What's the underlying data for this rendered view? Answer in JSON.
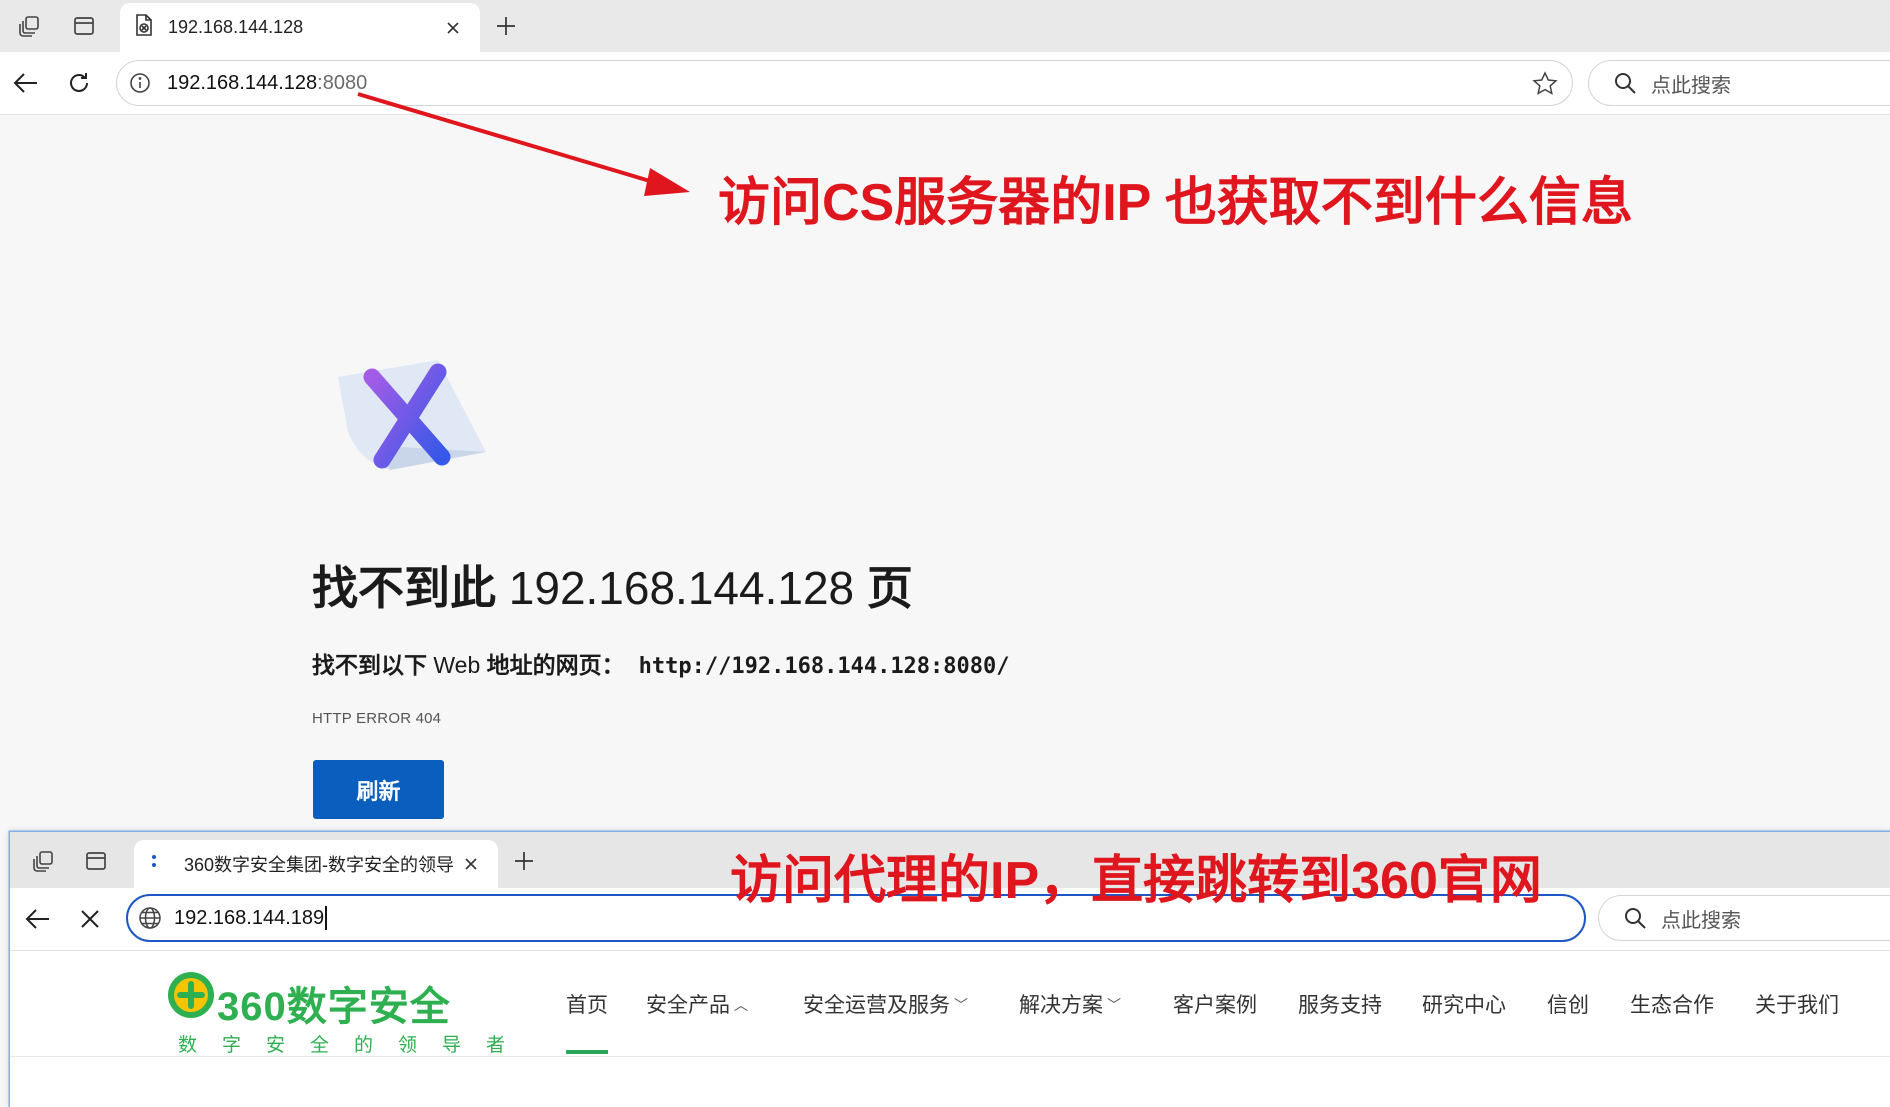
{
  "browser1": {
    "tab": {
      "title": "192.168.144.128"
    },
    "address": {
      "host": "192.168.144.128",
      "port": ":8080"
    },
    "search_placeholder": "点此搜索",
    "error": {
      "title_prefix": "找不到此",
      "title_ip": " 192.168.144.128 ",
      "title_suffix": "页",
      "desc_part1": "找不到以下",
      "desc_web": " Web ",
      "desc_part2": "地址的网页：",
      "url": "http://192.168.144.128:8080/",
      "code": "HTTP ERROR 404",
      "refresh_label": "刷新"
    }
  },
  "annotations": {
    "top": "访问CS服务器的IP 也获取不到什么信息",
    "bottom": "访问代理的IP，直接跳转到360官网",
    "color": "#e0161e"
  },
  "browser2": {
    "tab": {
      "title": "360数字安全集团-数字安全的领导"
    },
    "address": {
      "value": "192.168.144.189"
    },
    "search_placeholder": "点此搜索",
    "site": {
      "logo_text": "360数字安全",
      "logo_sub": "数字安全的领导者",
      "nav": [
        "首页",
        "安全产品",
        "安全运营及服务",
        "解决方案",
        "客户案例",
        "服务支持",
        "研究中心",
        "信创",
        "生态合作",
        "关于我们"
      ],
      "accent_color": "#27a85b"
    }
  }
}
